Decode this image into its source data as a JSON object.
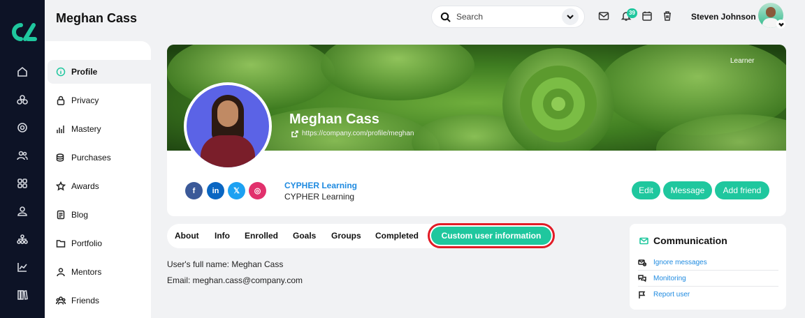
{
  "header": {
    "page_title": "Meghan Cass",
    "search_placeholder": "Search",
    "notifications_count": "39",
    "user_name": "Steven Johnson"
  },
  "rail": {
    "icons": [
      "home-icon",
      "catalog-icon",
      "target-icon",
      "people-icon",
      "apps-icon",
      "user-icon",
      "network-icon",
      "chart-icon",
      "library-icon"
    ]
  },
  "sidebar": {
    "items": [
      {
        "label": "Profile",
        "icon": "info-icon",
        "active": true
      },
      {
        "label": "Privacy",
        "icon": "lock-icon"
      },
      {
        "label": "Mastery",
        "icon": "bars-icon"
      },
      {
        "label": "Purchases",
        "icon": "coins-icon"
      },
      {
        "label": "Awards",
        "icon": "star-icon"
      },
      {
        "label": "Blog",
        "icon": "document-icon"
      },
      {
        "label": "Portfolio",
        "icon": "folder-icon"
      },
      {
        "label": "Mentors",
        "icon": "mentor-icon"
      },
      {
        "label": "Friends",
        "icon": "friends-icon"
      }
    ]
  },
  "profile": {
    "role": "Learner",
    "name": "Meghan Cass",
    "url": "https://company.com/profile/meghan",
    "organization_link": "CYPHER Learning",
    "organization_name": "CYPHER Learning",
    "social": [
      {
        "name": "facebook",
        "glyph": "f",
        "color": "#3b5998"
      },
      {
        "name": "linkedin",
        "glyph": "in",
        "color": "#0a66c2"
      },
      {
        "name": "x",
        "glyph": "𝕏",
        "color": "#1da1f2"
      },
      {
        "name": "instagram",
        "glyph": "◎",
        "color": "#e1306c"
      }
    ],
    "actions": {
      "edit": "Edit",
      "message": "Message",
      "add_friend": "Add friend"
    }
  },
  "tabs": [
    "About",
    "Info",
    "Enrolled",
    "Goals",
    "Groups",
    "Completed",
    "Custom user information"
  ],
  "active_tab": "Custom user information",
  "custom_info": {
    "full_name": "User's full name: Meghan Cass",
    "email": "Email: meghan.cass@company.com"
  },
  "communication": {
    "title": "Communication",
    "items": [
      "Ignore messages",
      "Monitoring",
      "Report user"
    ]
  },
  "colors": {
    "accent": "#1fc79e",
    "link": "#1e8ae0",
    "rail": "#0d1326",
    "highlight": "#e11b26"
  }
}
